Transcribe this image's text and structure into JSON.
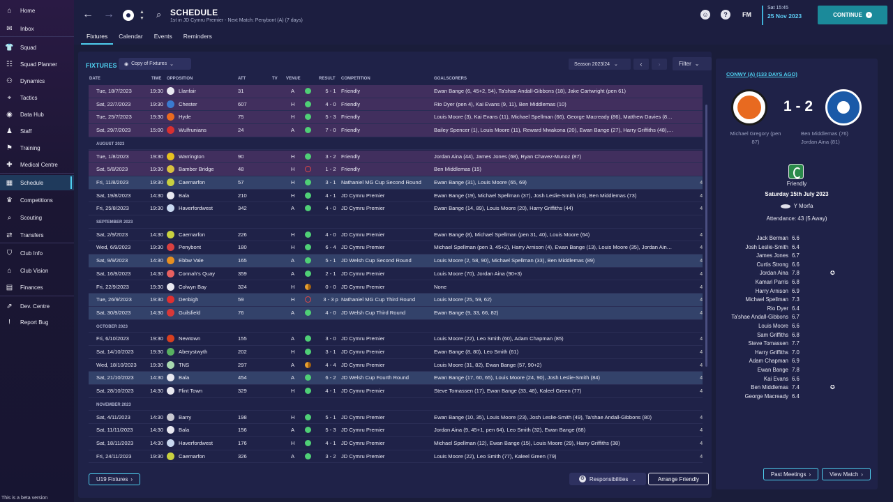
{
  "sidebar": {
    "items": [
      {
        "label": "Home",
        "icon": "⌂"
      },
      {
        "label": "Inbox",
        "icon": "✉"
      },
      {
        "label": "Squad",
        "icon": "👕"
      },
      {
        "label": "Squad Planner",
        "icon": "☷"
      },
      {
        "label": "Dynamics",
        "icon": "⚇"
      },
      {
        "label": "Tactics",
        "icon": "⌖"
      },
      {
        "label": "Data Hub",
        "icon": "◉"
      },
      {
        "label": "Staff",
        "icon": "♟"
      },
      {
        "label": "Training",
        "icon": "⚑"
      },
      {
        "label": "Medical Centre",
        "icon": "✚"
      },
      {
        "label": "Schedule",
        "icon": "▦"
      },
      {
        "label": "Competitions",
        "icon": "♛"
      },
      {
        "label": "Scouting",
        "icon": "⌕"
      },
      {
        "label": "Transfers",
        "icon": "⇄"
      },
      {
        "label": "Club Info",
        "icon": "⛉"
      },
      {
        "label": "Club Vision",
        "icon": "⌂"
      },
      {
        "label": "Finances",
        "icon": "▤"
      },
      {
        "label": "Dev. Centre",
        "icon": "⇗"
      },
      {
        "label": "Report Bug",
        "icon": "!"
      }
    ],
    "beta_note": "This is a beta version"
  },
  "header": {
    "title": "SCHEDULE",
    "subtitle": "1st in JD Cymru Premier - Next Match: Penybont (A) (7 days)",
    "tabs": [
      "Fixtures",
      "Calendar",
      "Events",
      "Reminders"
    ],
    "fm_logo": "FM",
    "time": "Sat 15:45",
    "date": "25 Nov 2023",
    "continue_label": "CONTINUE"
  },
  "fixtures": {
    "title": "FIXTURES",
    "copy_dropdown": "Copy of Fixtures",
    "season": "Season 2023/24",
    "filter_label": "Filter",
    "columns": [
      "DATE",
      "TIME",
      "OPPOSITION",
      "ATT",
      "TV",
      "VENUE",
      "RESULT",
      "COMPETITION",
      "GOALSCORERS"
    ],
    "rows": [
      {
        "type": "match",
        "style": "friendly",
        "date": "Tue, 18/7/2023",
        "time": "19:30",
        "badge": "#e8e8f0",
        "opp": "Llanfair",
        "att": "31",
        "venue": "A",
        "outcome": "w",
        "result": "5 - 1",
        "comp": "Friendly",
        "goals": "Ewan Bange (6, 45+2, 54), Ta'shae Andall-Gibbons (18), Jake Cartwright (pen 61)"
      },
      {
        "type": "match",
        "style": "friendly",
        "date": "Sat, 22/7/2023",
        "time": "19:30",
        "badge": "#3a7ad0",
        "opp": "Chester",
        "att": "607",
        "venue": "H",
        "outcome": "w",
        "result": "4 - 0",
        "comp": "Friendly",
        "goals": "Rio Dyer (pen 4), Kai Evans (9, 11), Ben Middlemas (10)"
      },
      {
        "type": "match",
        "style": "friendly",
        "date": "Tue, 25/7/2023",
        "time": "19:30",
        "badge": "#e86a20",
        "opp": "Hyde",
        "att": "75",
        "venue": "H",
        "outcome": "w",
        "result": "5 - 3",
        "comp": "Friendly",
        "goals": "Louis Moore (3), Kai Evans (11), Michael Spellman (66), George Macready (86), Matthew Davies (8…"
      },
      {
        "type": "match",
        "style": "friendly",
        "date": "Sat, 29/7/2023",
        "time": "15:00",
        "badge": "#d83030",
        "opp": "Wulfrunians",
        "att": "24",
        "venue": "A",
        "outcome": "w",
        "result": "7 - 0",
        "comp": "Friendly",
        "goals": "Bailey Spencer (1), Louis Moore (11), Reward Mwakona (20), Ewan Bange (27), Harry Griffiths (48),…"
      },
      {
        "type": "month",
        "label": "AUGUST 2023"
      },
      {
        "type": "match",
        "style": "friendly",
        "date": "Tue, 1/8/2023",
        "time": "19:30",
        "badge": "#e8c020",
        "opp": "Warrington",
        "att": "90",
        "venue": "H",
        "outcome": "w",
        "result": "3 - 2",
        "comp": "Friendly",
        "goals": "Jordan Aina (44), James Jones (68), Ryan Chavez-Munoz (87)"
      },
      {
        "type": "match",
        "style": "friendly",
        "date": "Sat, 5/8/2023",
        "time": "19:30",
        "badge": "#d8c040",
        "opp": "Bamber Bridge",
        "att": "48",
        "venue": "H",
        "outcome": "l",
        "result": "1 - 2",
        "comp": "Friendly",
        "goals": "Ben Middlemas (15)"
      },
      {
        "type": "match",
        "style": "cup",
        "date": "Fri, 11/8/2023",
        "time": "19:30",
        "badge": "#c8d040",
        "opp": "Caernarfon",
        "att": "57",
        "venue": "H",
        "outcome": "w",
        "result": "3 - 1",
        "comp": "Nathaniel MG Cup Second Round",
        "goals": "Ewan Bange (31), Louis Moore (65, 69)"
      },
      {
        "type": "match",
        "style": "",
        "date": "Sat, 19/8/2023",
        "time": "14:30",
        "badge": "#e8e8f0",
        "opp": "Bala",
        "att": "210",
        "venue": "H",
        "outcome": "w",
        "result": "4 - 1",
        "comp": "JD Cymru Premier",
        "goals": "Ewan Bange (19), Michael Spellman (37), Josh Leslie-Smith (40), Ben Middlemas (73)"
      },
      {
        "type": "match",
        "style": "",
        "date": "Fri, 25/8/2023",
        "time": "19:30",
        "badge": "#c8d8f0",
        "opp": "Haverfordwest",
        "att": "342",
        "venue": "A",
        "outcome": "w",
        "result": "4 - 0",
        "comp": "JD Cymru Premier",
        "goals": "Ewan Bange (14, 89), Louis Moore (20), Harry Griffiths (44)"
      },
      {
        "type": "month",
        "label": "SEPTEMBER 2023"
      },
      {
        "type": "match",
        "style": "",
        "date": "Sat, 2/9/2023",
        "time": "14:30",
        "badge": "#c8d040",
        "opp": "Caernarfon",
        "att": "226",
        "venue": "H",
        "outcome": "w",
        "result": "4 - 0",
        "comp": "JD Cymru Premier",
        "goals": "Ewan Bange (8), Michael Spellman (pen 31, 40), Louis Moore (64)"
      },
      {
        "type": "match",
        "style": "",
        "date": "Wed, 6/9/2023",
        "time": "19:30",
        "badge": "#d84040",
        "opp": "Penybont",
        "att": "180",
        "venue": "H",
        "outcome": "w",
        "result": "6 - 4",
        "comp": "JD Cymru Premier",
        "goals": "Michael Spellman (pen 3, 45+2), Harry Arnison (4), Ewan Bange (13), Louis Moore (35), Jordan Ain…"
      },
      {
        "type": "match",
        "style": "cup",
        "date": "Sat, 9/9/2023",
        "time": "14:30",
        "badge": "#e89020",
        "opp": "Ebbw Vale",
        "att": "165",
        "venue": "A",
        "outcome": "w",
        "result": "5 - 1",
        "comp": "JD Welsh Cup Second Round",
        "goals": "Louis Moore (2, 58, 90), Michael Spellman (33), Ben Middlemas (89)"
      },
      {
        "type": "match",
        "style": "",
        "date": "Sat, 16/9/2023",
        "time": "14:30",
        "badge": "#e86060",
        "opp": "Connah's Quay",
        "att": "359",
        "venue": "A",
        "outcome": "w",
        "result": "2 - 1",
        "comp": "JD Cymru Premier",
        "goals": "Louis Moore (70), Jordan Aina (90+3)"
      },
      {
        "type": "match",
        "style": "",
        "date": "Fri, 22/9/2023",
        "time": "19:30",
        "badge": "#e8e8f0",
        "opp": "Colwyn Bay",
        "att": "324",
        "venue": "H",
        "outcome": "d",
        "result": "0 - 0",
        "comp": "JD Cymru Premier",
        "goals": "None"
      },
      {
        "type": "match",
        "style": "cup",
        "date": "Tue, 26/9/2023",
        "time": "19:30",
        "badge": "#e03030",
        "opp": "Denbigh",
        "att": "59",
        "venue": "H",
        "outcome": "l",
        "result": "3 - 3 p",
        "comp": "Nathaniel MG Cup Third Round",
        "goals": "Louis Moore (25, 59, 62)"
      },
      {
        "type": "match",
        "style": "cup",
        "date": "Sat, 30/9/2023",
        "time": "14:30",
        "badge": "#d83838",
        "opp": "Guilsfield",
        "att": "76",
        "venue": "A",
        "outcome": "w",
        "result": "4 - 0",
        "comp": "JD Welsh Cup Third Round",
        "goals": "Ewan Bange (9, 33, 66, 82)"
      },
      {
        "type": "month",
        "label": "OCTOBER 2023"
      },
      {
        "type": "match",
        "style": "",
        "date": "Fri, 6/10/2023",
        "time": "19:30",
        "badge": "#d84020",
        "opp": "Newtown",
        "att": "155",
        "venue": "A",
        "outcome": "w",
        "result": "3 - 0",
        "comp": "JD Cymru Premier",
        "goals": "Louis Moore (22), Leo Smith (60), Adam Chapman (85)"
      },
      {
        "type": "match",
        "style": "",
        "date": "Sat, 14/10/2023",
        "time": "19:30",
        "badge": "#58b060",
        "opp": "Aberystwyth",
        "att": "202",
        "venue": "H",
        "outcome": "w",
        "result": "3 - 1",
        "comp": "JD Cymru Premier",
        "goals": "Ewan Bange (8, 80), Leo Smith (61)"
      },
      {
        "type": "match",
        "style": "",
        "date": "Wed, 18/10/2023",
        "time": "19:30",
        "badge": "#a8d8b0",
        "opp": "TNS",
        "att": "297",
        "venue": "A",
        "outcome": "d",
        "result": "4 - 4",
        "comp": "JD Cymru Premier",
        "goals": "Louis Moore (31, 82), Ewan Bange (57, 90+2)"
      },
      {
        "type": "match",
        "style": "cup",
        "date": "Sat, 21/10/2023",
        "time": "14:30",
        "badge": "#e8e8f0",
        "opp": "Bala",
        "att": "454",
        "venue": "A",
        "outcome": "w",
        "result": "6 - 2",
        "comp": "JD Welsh Cup Fourth Round",
        "goals": "Ewan Bange (17, 60, 65), Louis Moore (24, 90), Josh Leslie-Smith (84)"
      },
      {
        "type": "match",
        "style": "",
        "date": "Sat, 28/10/2023",
        "time": "14:30",
        "badge": "#e8e8f0",
        "opp": "Flint Town",
        "att": "329",
        "venue": "H",
        "outcome": "w",
        "result": "4 - 1",
        "comp": "JD Cymru Premier",
        "goals": "Steve Tomassen (17), Ewan Bange (33, 48), Kaleel Green (77)"
      },
      {
        "type": "month",
        "label": "NOVEMBER 2023"
      },
      {
        "type": "match",
        "style": "",
        "date": "Sat, 4/11/2023",
        "time": "14:30",
        "badge": "#c8c8d0",
        "opp": "Barry",
        "att": "198",
        "venue": "H",
        "outcome": "w",
        "result": "5 - 1",
        "comp": "JD Cymru Premier",
        "goals": "Ewan Bange (10, 35), Louis Moore (23), Josh Leslie-Smith (49), Ta'shae Andall-Gibbons (80)"
      },
      {
        "type": "match",
        "style": "",
        "date": "Sat, 11/11/2023",
        "time": "14:30",
        "badge": "#e8e8f0",
        "opp": "Bala",
        "att": "156",
        "venue": "A",
        "outcome": "w",
        "result": "5 - 3",
        "comp": "JD Cymru Premier",
        "goals": "Jordan Aina (9, 45+1, pen 64), Leo Smith (32), Ewan Bange (68)"
      },
      {
        "type": "match",
        "style": "",
        "date": "Sat, 18/11/2023",
        "time": "14:30",
        "badge": "#c8d8f0",
        "opp": "Haverfordwest",
        "att": "176",
        "venue": "H",
        "outcome": "w",
        "result": "4 - 1",
        "comp": "JD Cymru Premier",
        "goals": "Michael Spellman (12), Ewan Bange (15), Louis Moore (29), Harry Griffiths (38)"
      },
      {
        "type": "match",
        "style": "",
        "date": "Fri, 24/11/2023",
        "time": "19:30",
        "badge": "#c8d040",
        "opp": "Caernarfon",
        "att": "326",
        "venue": "A",
        "outcome": "w",
        "result": "3 - 2",
        "comp": "JD Cymru Premier",
        "goals": "Louis Moore (22), Leo Smith (77), Kaleel Green (79)"
      }
    ],
    "edge_value": "4",
    "u19_label": "U19 Fixtures",
    "responsibilities_label": "Responsibilities",
    "arrange_label": "Arrange Friendly"
  },
  "match_panel": {
    "link": "CONWY (A) (133 DAYS AGO)",
    "score": "1 - 2",
    "home_scorers": "Michael Gregory (pen 87)",
    "away_scorers": [
      "Ben Middlemas (76)",
      "Jordan Aina (81)"
    ],
    "competition": "Friendly",
    "date": "Saturday 15th July 2023",
    "venue": "Y Morfa",
    "attendance": "Attendance: 43 (5 Away)",
    "players": [
      {
        "name": "Jack Berman",
        "rating": "6.6",
        "star": false
      },
      {
        "name": "Josh Leslie-Smith",
        "rating": "6.4",
        "star": false
      },
      {
        "name": "James Jones",
        "rating": "6.7",
        "star": false
      },
      {
        "name": "Curtis Strong",
        "rating": "6.6",
        "star": false
      },
      {
        "name": "Jordan Aina",
        "rating": "7.8",
        "star": true
      },
      {
        "name": "Kamari Parris",
        "rating": "6.8",
        "star": false
      },
      {
        "name": "Harry Arnison",
        "rating": "6.9",
        "star": false
      },
      {
        "name": "Michael Spellman",
        "rating": "7.3",
        "star": false
      },
      {
        "name": "Rio Dyer",
        "rating": "6.4",
        "star": false
      },
      {
        "name": "Ta'shae Andall-Gibbons",
        "rating": "6.7",
        "star": false
      },
      {
        "name": "Louis Moore",
        "rating": "6.6",
        "star": false
      },
      {
        "name": "Sam Griffiths",
        "rating": "6.8",
        "star": false
      },
      {
        "name": "Steve Tomassen",
        "rating": "7.7",
        "star": false
      },
      {
        "name": "Harry Griffiths",
        "rating": "7.0",
        "star": false
      },
      {
        "name": "Adam Chapman",
        "rating": "6.9",
        "star": false
      },
      {
        "name": "Ewan Bange",
        "rating": "7.8",
        "star": false
      },
      {
        "name": "Kai Evans",
        "rating": "6.6",
        "star": false
      },
      {
        "name": "Ben Middlemas",
        "rating": "7.4",
        "star": true
      },
      {
        "name": "George Macready",
        "rating": "6.4",
        "star": false
      }
    ],
    "past_meetings_label": "Past Meetings",
    "view_match_label": "View Match"
  }
}
